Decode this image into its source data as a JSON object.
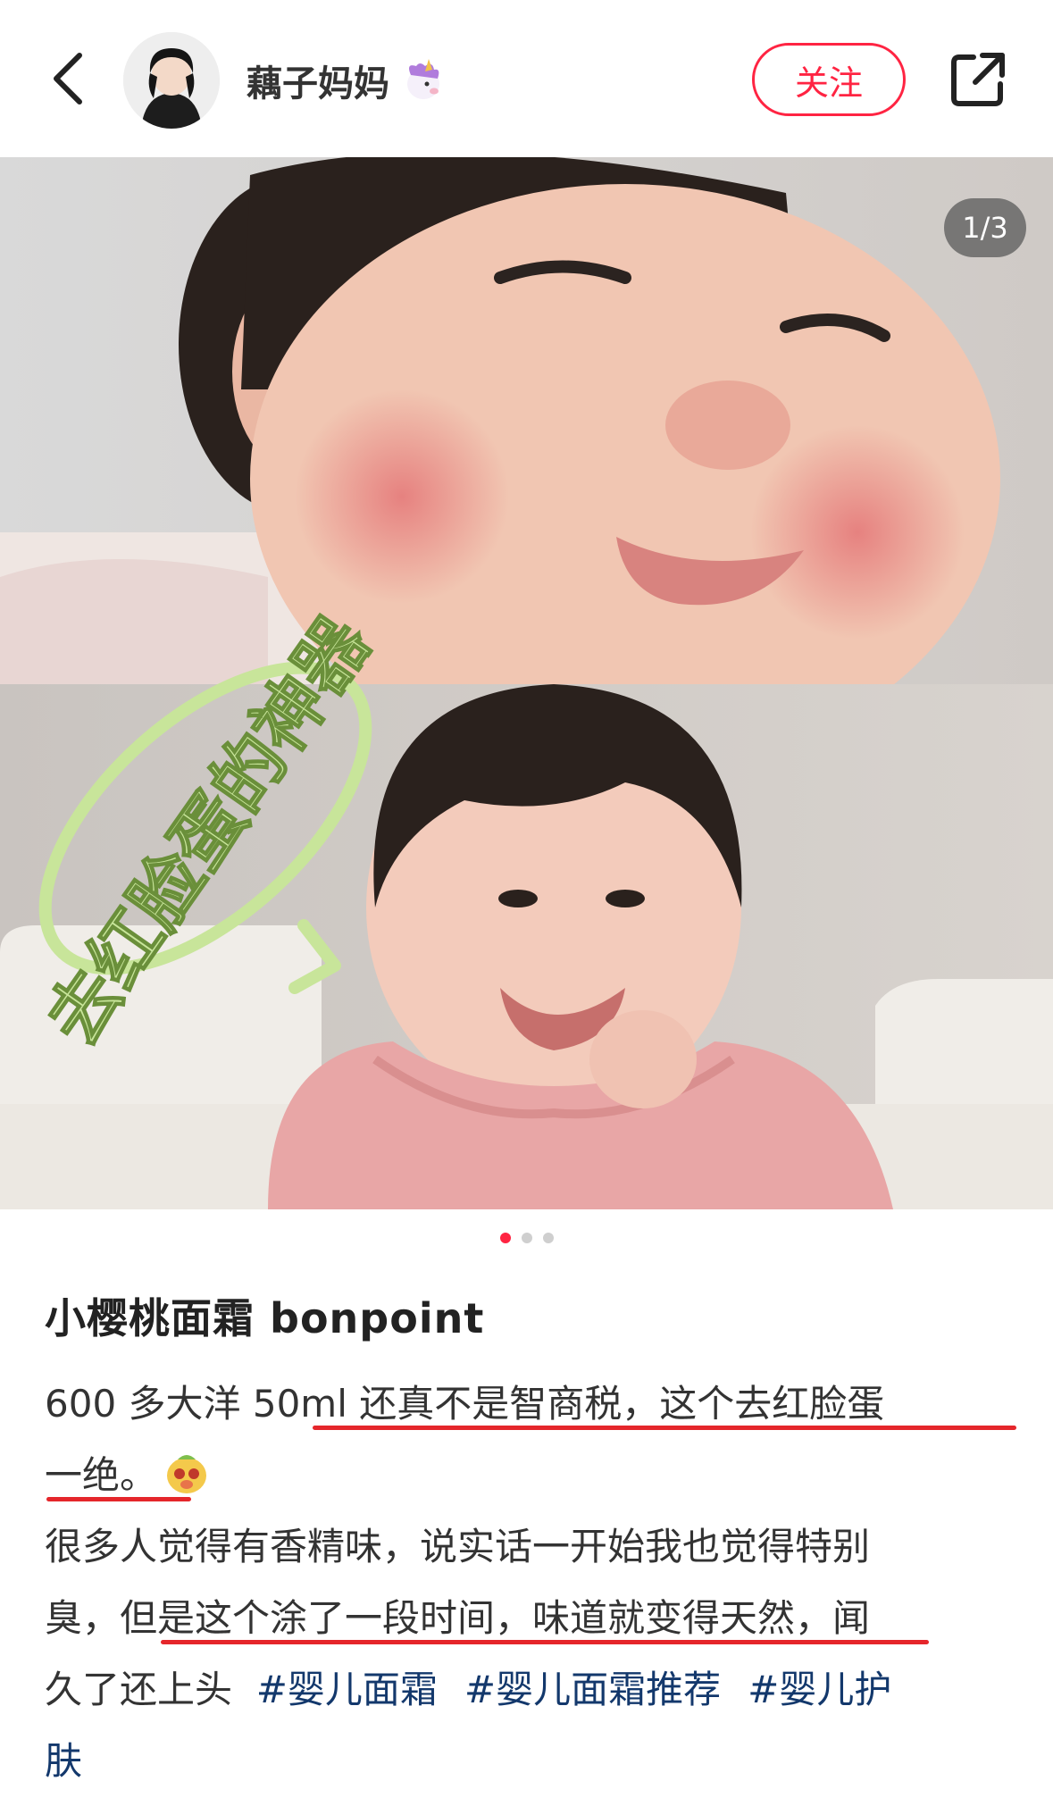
{
  "header": {
    "author_name": "藕子妈妈",
    "follow_label": "关注"
  },
  "carousel": {
    "page_counter": "1/3",
    "overlay_text": "去红脸蛋的神器",
    "dots": {
      "total": 3,
      "active": 1
    }
  },
  "post": {
    "title": "小樱桃面霜 bonpoint",
    "lines": [
      "600 多大洋 50ml 还真不是智商税，这个去红脸蛋",
      "一绝。",
      "很多人觉得有香精味，说实话一开始我也觉得特别",
      "臭，但是这个涂了一段时间，味道就变得天然，闻",
      "久了还上头"
    ],
    "tags": [
      "#婴儿面霜",
      "#婴儿面霜推荐",
      "#婴儿护"
    ],
    "tag_continuation": "肤"
  },
  "colors": {
    "accent": "#ff2442",
    "tag": "#13386c",
    "underline": "#e5262b",
    "overlay_text": "#c8e59a"
  }
}
